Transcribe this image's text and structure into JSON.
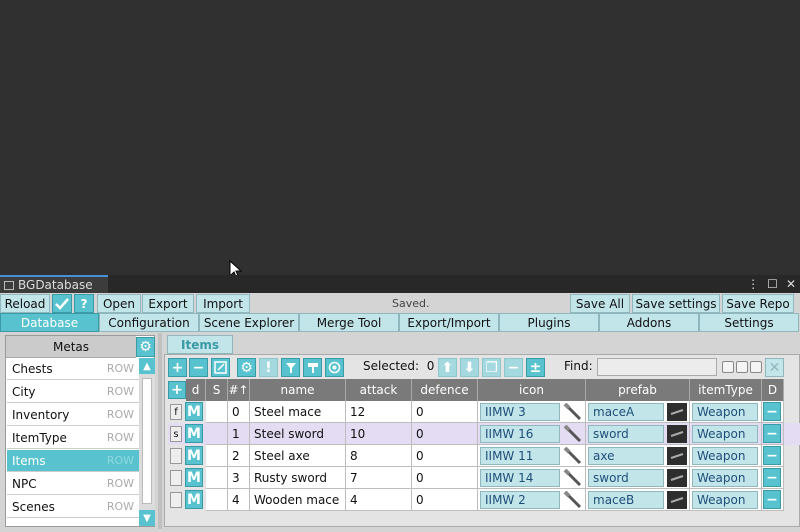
{
  "window": {
    "tab_title": "BGDatabase",
    "kebab": "⋮",
    "maximize": "☐",
    "close": "✕"
  },
  "toolbar": {
    "reload": "Reload",
    "open": "Open",
    "export": "Export",
    "import": "Import",
    "status": "Saved.",
    "save_all": "Save All",
    "save_settings": "Save settings",
    "save_repo": "Save Repo"
  },
  "nav": [
    "Database",
    "Configuration",
    "Scene Explorer",
    "Merge Tool",
    "Export/Import",
    "Plugins",
    "Addons",
    "Settings"
  ],
  "metas": {
    "header": "Metas",
    "row_label": "ROW",
    "items": [
      "Chests",
      "City",
      "Inventory",
      "ItemType",
      "Items",
      "NPC",
      "Scenes"
    ],
    "selected": "Items"
  },
  "items_panel": {
    "tab": "Items",
    "selected_label": "Selected:",
    "selected_count": "0",
    "find_label": "Find:",
    "columns": [
      "d",
      "S",
      "#↑",
      "name",
      "attack",
      "defence",
      "icon",
      "prefab",
      "itemType",
      "D"
    ],
    "rows": [
      {
        "flag": "f",
        "index": "0",
        "name": "Steel mace",
        "attack": "12",
        "defence": "0",
        "icon": "IIMW 3",
        "prefab": "maceA",
        "itemType": "Weapon"
      },
      {
        "flag": "s",
        "index": "1",
        "name": "Steel sword",
        "attack": "10",
        "defence": "0",
        "icon": "IIMW 16",
        "prefab": "sword",
        "itemType": "Weapon"
      },
      {
        "flag": "",
        "index": "2",
        "name": "Steel axe",
        "attack": "8",
        "defence": "0",
        "icon": "IIMW 11",
        "prefab": "axe",
        "itemType": "Weapon"
      },
      {
        "flag": "",
        "index": "3",
        "name": "Rusty sword",
        "attack": "7",
        "defence": "0",
        "icon": "IIMW 14",
        "prefab": "sword",
        "itemType": "Weapon"
      },
      {
        "flag": "",
        "index": "4",
        "name": "Wooden mace",
        "attack": "4",
        "defence": "0",
        "icon": "IIMW 2",
        "prefab": "maceB",
        "itemType": "Weapon"
      }
    ],
    "selected_row": 1
  },
  "colors": {
    "accent": "#58c3cf",
    "light_accent": "#c2e5ea",
    "header_gray": "#7a7a7a",
    "selected_row": "#e3dcf2",
    "scene_bg": "#303030"
  }
}
